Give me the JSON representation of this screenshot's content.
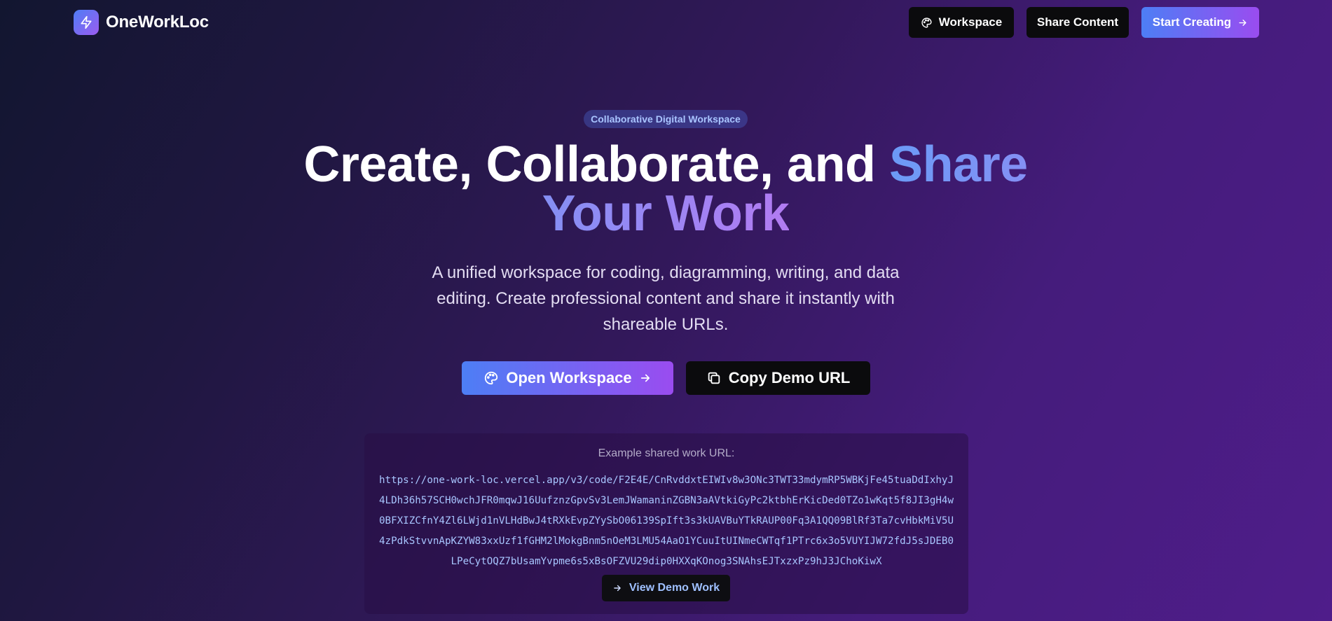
{
  "brand": {
    "name": "OneWorkLoc",
    "icon": "lightning-icon"
  },
  "nav": {
    "workspace_label": "Workspace",
    "share_label": "Share Content",
    "start_label": "Start Creating"
  },
  "hero": {
    "badge": "Collaborative Digital Workspace",
    "headline_plain": "Create, Collaborate, and ",
    "headline_highlight": "Share Your Work",
    "subtitle": "A unified workspace for coding, diagramming, writing, and data editing. Create professional content and share it instantly with shareable URLs.",
    "open_workspace_label": "Open Workspace",
    "copy_demo_label": "Copy Demo URL"
  },
  "example": {
    "caption": "Example shared work URL:",
    "url": "https://one-work-loc.vercel.app/v3/code/F2E4E/CnRvddxtEIWIv8w3ONc3TWT33mdymRP5WBKjFe45tuaDdIxhyJ4LDh36h57SCH0wchJFR0mqwJ16UufznzGpvSv3LemJWamaninZGBN3aAVtkiGyPc2ktbhErKicDed0TZo1wKqt5f8JI3gH4w0BFXIZCfnY4Zl6LWjd1nVLHdBwJ4tRXkEvpZYySbO06139SpIft3s3kUAVBuYTkRAUP00Fq3A1QQ09BlRf3Ta7cvHbkMiV5U4zPdkStvvnApKZYW83xxUzf1fGHM2lMokgBnm5nOeM3LMU54AaO1YCuuItUINmeCWTqf1PTrc6x3o5VUYIJW72fdJ5sJDEB0LPeCytOQZ7bUsamYvpme6s5xBsOFZVU29dip0HXXqKOnog3SNAhsEJTxzxPz9hJ3JChoKiwX",
    "view_demo_label": "View Demo Work"
  },
  "colors": {
    "accent_blue": "#4d7ef5",
    "accent_purple": "#9a4cf0",
    "url_text": "#a8c6ff"
  }
}
